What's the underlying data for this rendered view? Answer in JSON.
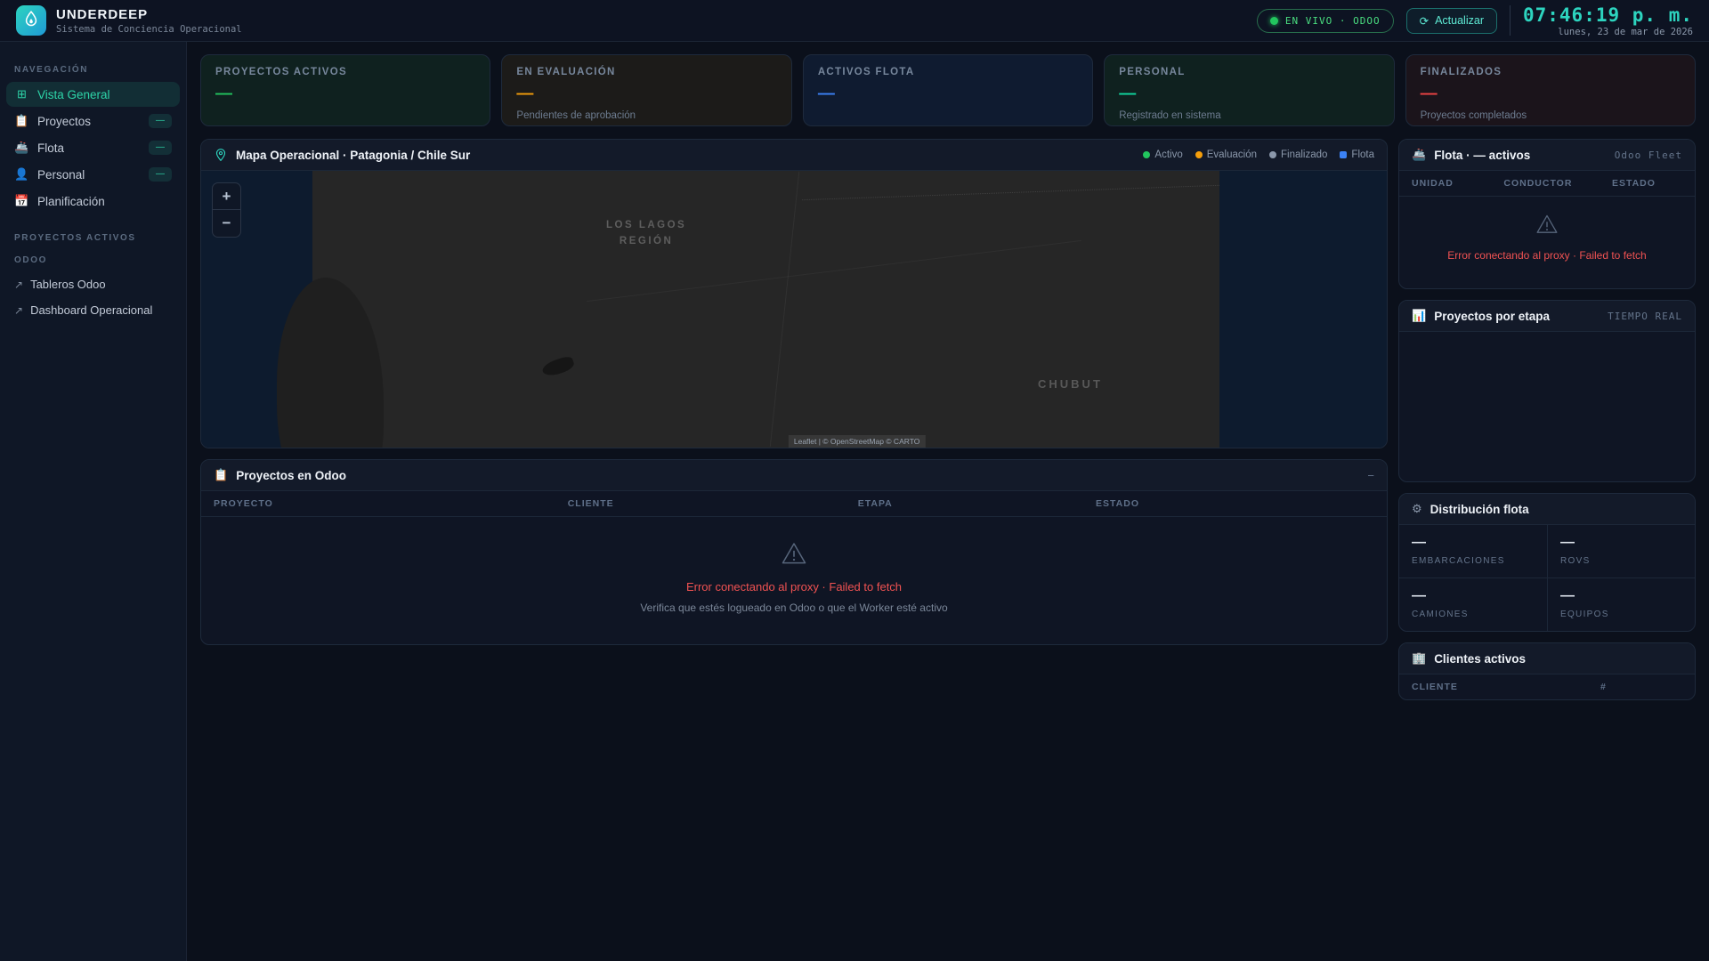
{
  "colors": {
    "accent_teal": "#2dd4bf",
    "status_green": "#22c55e",
    "status_orange": "#f59e0b",
    "status_blue": "#3b82f6",
    "status_red": "#ef4444",
    "status_gray": "#94a3b8",
    "error_red": "#f05252"
  },
  "header": {
    "app_name": "UNDERDEEP",
    "app_subtitle": "Sistema de Conciencia Operacional",
    "live_badge_label": "EN VIVO · ODOO",
    "refresh_icon": "⟳",
    "refresh_label": "Actualizar",
    "clock_time": "07:46:19 p. m.",
    "clock_date": "lunes, 23 de mar de 2026"
  },
  "sidebar": {
    "nav_label": "NAVEGACIÓN",
    "items": [
      {
        "icon": "⊞",
        "label": "Vista General"
      },
      {
        "icon": "📋",
        "label": "Proyectos",
        "badge": "—"
      },
      {
        "icon": "🚢",
        "label": "Flota",
        "badge": "—"
      },
      {
        "icon": "👤",
        "label": "Personal",
        "badge": "—"
      },
      {
        "icon": "📅",
        "label": "Planificación"
      }
    ],
    "projects_label": "PROYECTOS ACTIVOS",
    "odoo_label": "ODOO",
    "odoo_links": [
      {
        "icon": "↗",
        "label": "Tableros Odoo"
      },
      {
        "icon": "↗",
        "label": "Dashboard Operacional"
      }
    ]
  },
  "kpis": [
    {
      "label": "PROYECTOS ACTIVOS",
      "value": "—",
      "subtitle": ""
    },
    {
      "label": "EN EVALUACIÓN",
      "value": "—",
      "subtitle": "Pendientes de aprobación"
    },
    {
      "label": "ACTIVOS FLOTA",
      "value": "—",
      "subtitle": ""
    },
    {
      "label": "PERSONAL",
      "value": "—",
      "subtitle": "Registrado en sistema"
    },
    {
      "label": "FINALIZADOS",
      "value": "—",
      "subtitle": "Proyectos completados"
    }
  ],
  "map": {
    "title": "Mapa Operacional · Patagonia / Chile Sur",
    "legend": [
      {
        "label": "Activo"
      },
      {
        "label": "Evaluación"
      },
      {
        "label": "Finalizado"
      },
      {
        "label": "Flota"
      }
    ],
    "zoom_in": "+",
    "zoom_out": "−",
    "region_line_1": "LOS LAGOS",
    "region_line_2": "REGIÓN",
    "region_chubut": "CHUBUT",
    "attribution": "Leaflet | © OpenStreetMap © CARTO"
  },
  "projects_table": {
    "icon": "📋",
    "title": "Proyectos en Odoo",
    "collapse_glyph": "−",
    "columns": [
      "PROYECTO",
      "CLIENTE",
      "ETAPA",
      "ESTADO"
    ],
    "error_title": "Error conectando al proxy · Failed to fetch",
    "error_subtitle": "Verifica que estés logueado en Odoo o que el Worker esté activo"
  },
  "fleet_panel": {
    "icon": "🚢",
    "title": "Flota · — activos",
    "source_tag": "Odoo Fleet",
    "columns": [
      "UNIDAD",
      "CONDUCTOR",
      "ESTADO"
    ],
    "error_title": "Error conectando al proxy · Failed to fetch"
  },
  "stages_panel": {
    "icon": "📊",
    "title": "Proyectos por etapa",
    "tag": "TIEMPO REAL"
  },
  "distribution_panel": {
    "icon": "⚙",
    "title": "Distribución flota",
    "cells": [
      {
        "value": "—",
        "label": "EMBARCACIONES"
      },
      {
        "value": "—",
        "label": "ROVS"
      },
      {
        "value": "—",
        "label": "CAMIONES"
      },
      {
        "value": "—",
        "label": "EQUIPOS"
      }
    ]
  },
  "clients_panel": {
    "icon": "🏢",
    "title": "Clientes activos",
    "columns": [
      "CLIENTE",
      "#"
    ]
  }
}
